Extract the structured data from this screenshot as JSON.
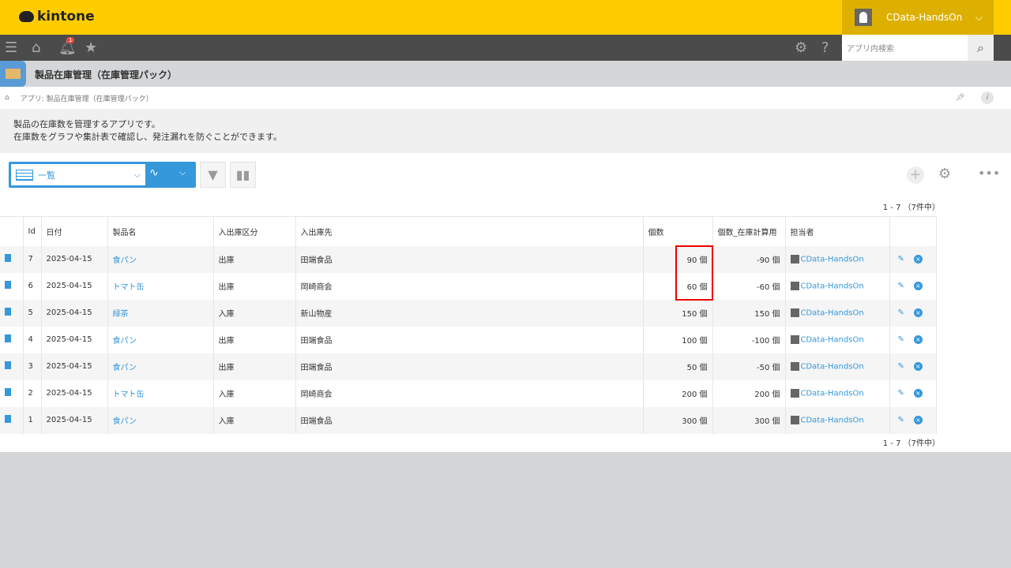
{
  "header": {
    "logo": "kintone",
    "user": "CData-HandsOn",
    "notification_count": "1",
    "search_placeholder": "アプリ内検索"
  },
  "app": {
    "title": "製品在庫管理（在庫管理パック）",
    "breadcrumb": "アプリ: 製品在庫管理（在庫管理パック）",
    "description_line1": "製品の在庫数を管理するアプリです。",
    "description_line2": "在庫数をグラフや集計表で確認し、発注漏れを防ぐことができます。"
  },
  "view": {
    "selected": "一覧",
    "pager_top": "1 - 7 （7件中）",
    "pager_bottom": "1 - 7 （7件中）"
  },
  "table": {
    "columns": [
      "Id",
      "日付",
      "製品名",
      "入出庫区分",
      "入出庫先",
      "個数",
      "個数_在庫計算用",
      "担当者"
    ],
    "rows": [
      {
        "id": "7",
        "date": "2025-04-15",
        "product": "食パン",
        "kubun": "出庫",
        "partner": "田端食品",
        "qty": "90 個",
        "calc": "-90 個",
        "owner": "CData-HandsOn"
      },
      {
        "id": "6",
        "date": "2025-04-15",
        "product": "トマト缶",
        "kubun": "出庫",
        "partner": "岡崎商会",
        "qty": "60 個",
        "calc": "-60 個",
        "owner": "CData-HandsOn"
      },
      {
        "id": "5",
        "date": "2025-04-15",
        "product": "緑茶",
        "kubun": "入庫",
        "partner": "新山物産",
        "qty": "150 個",
        "calc": "150 個",
        "owner": "CData-HandsOn"
      },
      {
        "id": "4",
        "date": "2025-04-15",
        "product": "食パン",
        "kubun": "出庫",
        "partner": "田端食品",
        "qty": "100 個",
        "calc": "-100 個",
        "owner": "CData-HandsOn"
      },
      {
        "id": "3",
        "date": "2025-04-15",
        "product": "食パン",
        "kubun": "出庫",
        "partner": "田端食品",
        "qty": "50 個",
        "calc": "-50 個",
        "owner": "CData-HandsOn"
      },
      {
        "id": "2",
        "date": "2025-04-15",
        "product": "トマト缶",
        "kubun": "入庫",
        "partner": "岡崎商会",
        "qty": "200 個",
        "calc": "200 個",
        "owner": "CData-HandsOn"
      },
      {
        "id": "1",
        "date": "2025-04-15",
        "product": "食パン",
        "kubun": "入庫",
        "partner": "田端食品",
        "qty": "300 個",
        "calc": "300 個",
        "owner": "CData-HandsOn"
      }
    ]
  },
  "colors": {
    "header": "#ffcc00",
    "nav": "#4b4b4b",
    "accent": "#3498db",
    "highlight": "#e00000"
  }
}
